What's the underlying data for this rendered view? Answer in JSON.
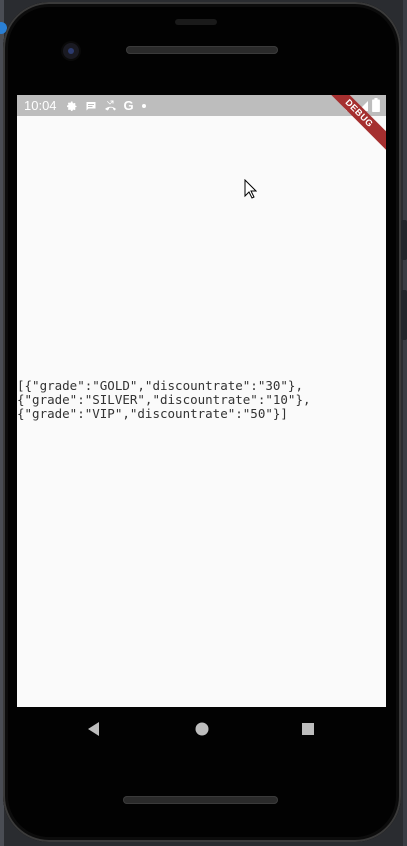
{
  "status_bar": {
    "time": "10:04",
    "icons": [
      "settings-gear-icon",
      "message-icon",
      "missed-call-icon",
      "google-g-icon",
      "dot-icon"
    ],
    "right_icons": [
      "wifi-icon",
      "signal-icon",
      "battery-icon"
    ],
    "google_glyph": "G"
  },
  "debug_banner": {
    "label": "DEBUG",
    "color": "#a52f2f"
  },
  "content": {
    "json_text": "[{\"grade\":\"GOLD\",\"discountrate\":\"30\"},\n{\"grade\":\"SILVER\",\"discountrate\":\"10\"},\n{\"grade\":\"VIP\",\"discountrate\":\"50\"}]"
  },
  "nav_bar": {
    "buttons": [
      "back-icon",
      "home-icon",
      "recents-icon"
    ]
  },
  "colors": {
    "status_bar": "#bdbdbd",
    "screen_bg": "#fafafa",
    "text": "#333333"
  }
}
